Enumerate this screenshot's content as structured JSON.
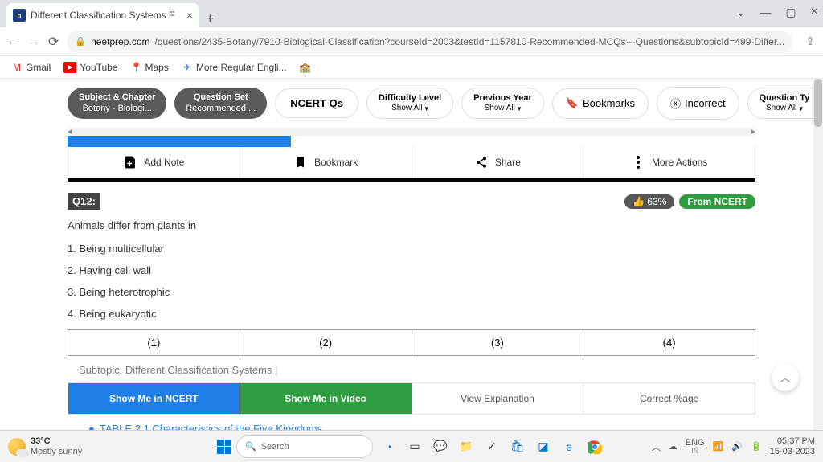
{
  "browser": {
    "tab_title": "Different Classification Systems F",
    "url_domain": "neetprep.com",
    "url_path": "/questions/2435-Botany/7910-Biological-Classification?courseId=2003&testId=1157810-Recommended-MCQs---Questions&subtopicId=499-Differ...",
    "bookmarks": [
      "Gmail",
      "YouTube",
      "Maps",
      "More Regular Engli..."
    ]
  },
  "pills": {
    "subject_label": "Subject & Chapter",
    "subject_value": "Botany - Biologi...",
    "qset_label": "Question Set",
    "qset_value": "Recommended ...",
    "ncert": "NCERT Qs",
    "difficulty_label": "Difficulty Level",
    "show_all": "Show All",
    "prev_label": "Previous Year",
    "bookmarks": "Bookmarks",
    "incorrect": "Incorrect",
    "qtype_label": "Question Ty",
    "qtype_value": "Show All"
  },
  "actions": {
    "add_note": "Add Note",
    "bookmark": "Bookmark",
    "share": "Share",
    "more": "More Actions"
  },
  "question": {
    "number": "Q12:",
    "pct": "63%",
    "source": "From NCERT",
    "stem": "Animals differ from plants in",
    "opts": [
      "1. Being multicellular",
      "2. Having cell wall",
      "3. Being heterotrophic",
      "4. Being eukaryotic"
    ],
    "answers": [
      "(1)",
      "(2)",
      "(3)",
      "(4)"
    ]
  },
  "subtopic_label": "Subtopic:",
  "subtopic_value": "Different Classification Systems |",
  "cta": {
    "ncert": "Show Me in NCERT",
    "video": "Show Me in Video",
    "explain": "View Explanation",
    "pct": "Correct %age"
  },
  "table_link": "TABLE 2.1  Characteristics of the Five Kingdoms",
  "taskbar": {
    "temp": "33°C",
    "condition": "Mostly sunny",
    "search": "Search",
    "lang": "ENG",
    "lang_sub": "IN",
    "time": "05:37 PM",
    "date": "15-03-2023"
  }
}
